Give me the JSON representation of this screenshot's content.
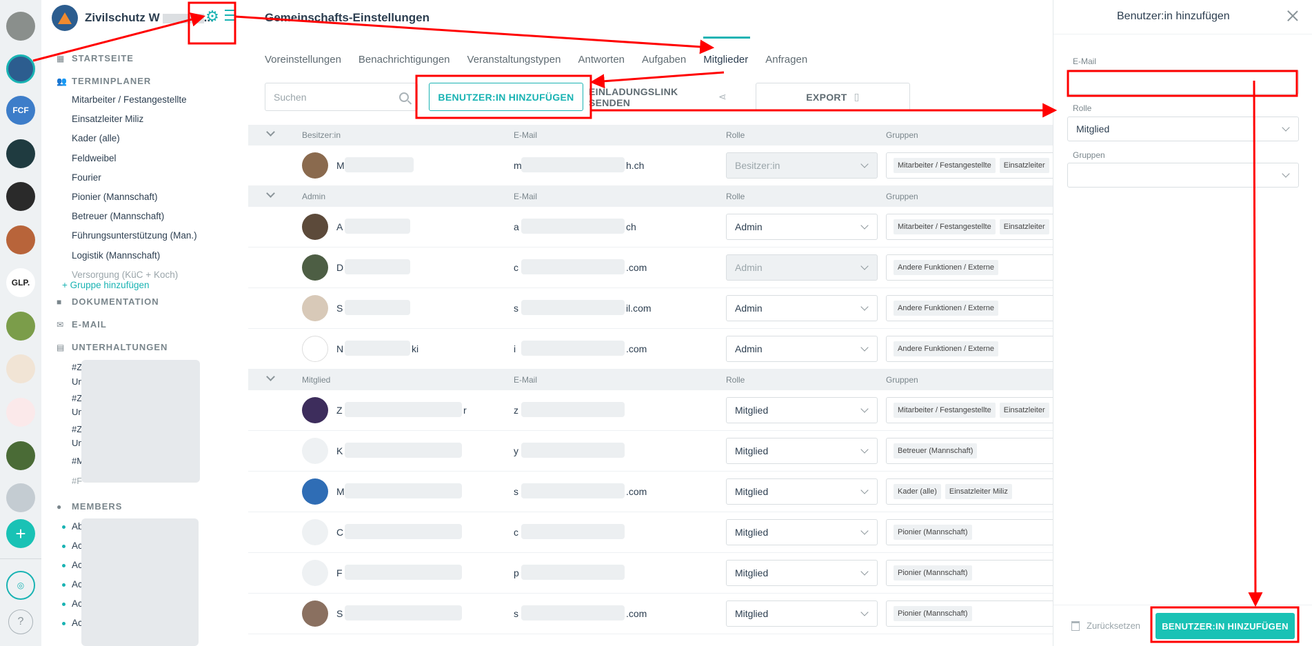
{
  "rail": {
    "avatars": [
      {
        "color": "#8a8f8c",
        "label": ""
      },
      {
        "color": "#2c5d8f",
        "label": ""
      },
      {
        "color": "#3d7dc9",
        "label": "FCF"
      },
      {
        "color": "#1f3b40",
        "label": ""
      },
      {
        "color": "#2a2a2a",
        "label": ""
      },
      {
        "color": "#b8643a",
        "label": ""
      },
      {
        "color": "#ffffff",
        "label": "GLP."
      },
      {
        "color": "#7b9d4a",
        "label": ""
      },
      {
        "color": "#f1e4d5",
        "label": ""
      },
      {
        "color": "#fbe9ea",
        "label": ""
      },
      {
        "color": "#4a6b36",
        "label": ""
      },
      {
        "color": "#c4ccd2",
        "label": ""
      }
    ],
    "add_label": "+",
    "help_label": "?"
  },
  "nav": {
    "community_title": "Zivilschutz W",
    "community_ellipsis": "...",
    "sections": {
      "home": "STARTSEITE",
      "planner": "TERMINPLANER",
      "docs": "DOKUMENTATION",
      "email": "E-MAIL",
      "chats": "UNTERHALTUNGEN",
      "members": "MEMBERS"
    },
    "planner_items": [
      "Mitarbeiter / Festangestellte",
      "Einsatzleiter Miliz",
      "Kader (alle)",
      "Feldweibel",
      "Fourier",
      "Pionier (Mannschaft)",
      "Betreuer (Mannschaft)",
      "Führungsunterstützung (Man.)",
      "Logistik (Mannschaft)",
      "Versorgung (KüC + Koch)"
    ],
    "add_group": "Gruppe hinzufügen",
    "chat_items": [
      "#Z",
      "Un",
      "#Z",
      "Un",
      "#Z",
      "Un",
      "#M",
      "#F"
    ],
    "member_items": [
      "Ab",
      "Ac",
      "Ac",
      "Ac",
      "Ac",
      "Ac"
    ]
  },
  "main": {
    "title": "Gemeinschafts-Einstellungen",
    "tabs": [
      "Voreinstellungen",
      "Benachrichtigungen",
      "Veranstaltungstypen",
      "Antworten",
      "Aufgaben",
      "Mitglieder",
      "Anfragen"
    ],
    "active_tab": "Mitglieder",
    "search_placeholder": "Suchen",
    "add_user_button": "BENUTZER:IN HINZUFÜGEN",
    "invite_button": "EINLADUNGSLINK SENDEN",
    "export_button": "EXPORT",
    "columns": {
      "email": "E-Mail",
      "role": "Rolle",
      "groups": "Gruppen"
    },
    "groups": [
      {
        "label": "Besitzer:in",
        "rows": [
          {
            "name": "M",
            "email": "m",
            "email_tail": "h.ch",
            "role": "Besitzer:in",
            "disabled": true,
            "avatar": "#8a6a4e",
            "chips": [
              "Mitarbeiter / Festangestellte",
              "Einsatzleiter"
            ]
          }
        ]
      },
      {
        "label": "Admin",
        "rows": [
          {
            "name": "A",
            "email": "a",
            "email_tail": "ch",
            "role": "Admin",
            "disabled": false,
            "avatar": "#5c4a3a",
            "chips": [
              "Mitarbeiter / Festangestellte",
              "Einsatzleiter"
            ]
          },
          {
            "name": "D",
            "email": "c",
            "email_tail": ".com",
            "role": "Admin",
            "disabled": true,
            "avatar": "#4d5e44",
            "chips": [
              "Andere Funktionen / Externe"
            ]
          },
          {
            "name": "S",
            "email": "s",
            "email_tail": "il.com",
            "role": "Admin",
            "disabled": false,
            "avatar": "#d8c9b8",
            "chips": [
              "Andere Funktionen / Externe"
            ]
          },
          {
            "name": "N",
            "email": "i",
            "email_tail": ".com",
            "role": "Admin",
            "disabled": false,
            "avatar": "#ffffff",
            "chips": [
              "Andere Funktionen / Externe"
            ],
            "name_tail": "ki"
          }
        ]
      },
      {
        "label": "Mitglied",
        "rows": [
          {
            "name": "Z",
            "email": "z",
            "email_tail": "",
            "role": "Mitglied",
            "disabled": false,
            "avatar": "#3d2d5c",
            "chips": [
              "Mitarbeiter / Festangestellte",
              "Einsatzleiter"
            ],
            "name_tail": "r"
          },
          {
            "name": "K",
            "email": "y",
            "email_tail": "",
            "role": "Mitglied",
            "disabled": false,
            "avatar": "#eef1f3",
            "chips": [
              "Betreuer (Mannschaft)"
            ]
          },
          {
            "name": "M",
            "email": "s",
            "email_tail": ".com",
            "role": "Mitglied",
            "disabled": false,
            "avatar": "#2f6db5",
            "chips": [
              "Kader (alle)",
              "Einsatzleiter Miliz"
            ]
          },
          {
            "name": "C",
            "email": "c",
            "email_tail": "",
            "role": "Mitglied",
            "disabled": false,
            "avatar": "#eef1f3",
            "chips": [
              "Pionier (Mannschaft)"
            ]
          },
          {
            "name": "F",
            "email": "p",
            "email_tail": "",
            "role": "Mitglied",
            "disabled": false,
            "avatar": "#eef1f3",
            "chips": [
              "Pionier (Mannschaft)"
            ]
          },
          {
            "name": "S",
            "email": "s",
            "email_tail": ".com",
            "role": "Mitglied",
            "disabled": false,
            "avatar": "#8a7060",
            "chips": [
              "Pionier (Mannschaft)"
            ]
          }
        ]
      }
    ]
  },
  "drawer": {
    "title": "Benutzer:in hinzufügen",
    "email_label": "E-Mail",
    "email_value": "",
    "role_label": "Rolle",
    "role_value": "Mitglied",
    "groups_label": "Gruppen",
    "groups_value": "",
    "reset_label": "Zurücksetzen",
    "submit_label": "BENUTZER:IN HINZUFÜGEN"
  },
  "colors": {
    "accent": "#19b3b3",
    "annotation": "#ff0000"
  }
}
